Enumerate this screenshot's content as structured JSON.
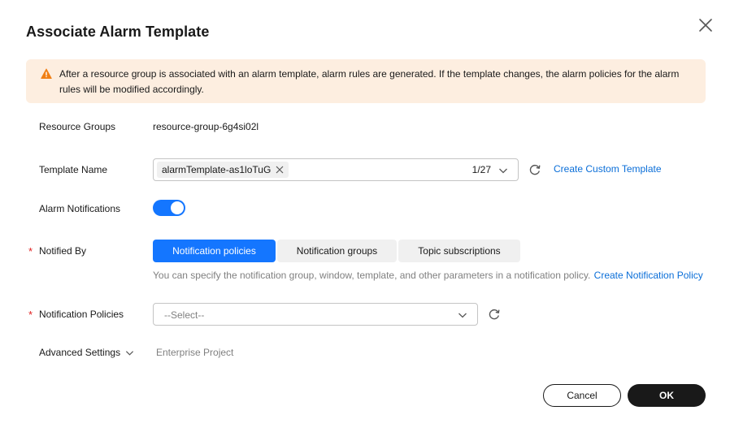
{
  "dialog": {
    "title": "Associate Alarm Template",
    "close_icon": "close-icon"
  },
  "alert": {
    "icon": "warning-icon",
    "color": "#fdeee0",
    "icon_color": "#f07f15",
    "text": "After a resource group is associated with an alarm template, alarm rules are generated. If the template changes, the alarm policies for the alarm rules will be modified accordingly."
  },
  "form": {
    "resource_groups": {
      "label": "Resource Groups",
      "value": "resource-group-6g4si02l"
    },
    "template_name": {
      "label": "Template Name",
      "tag": "alarmTemplate-as1loTuG",
      "count": "1/27",
      "refresh_icon": "refresh-icon",
      "link": "Create Custom Template"
    },
    "alarm_notifications": {
      "label": "Alarm Notifications",
      "enabled": true
    },
    "notified_by": {
      "required_mark": "*",
      "label": "Notified By",
      "options": [
        "Notification policies",
        "Notification groups",
        "Topic subscriptions"
      ],
      "selected": "Notification policies",
      "hint": "You can specify the notification group, window, template, and other parameters in a notification policy.",
      "link": "Create Notification Policy"
    },
    "notification_policies": {
      "required_mark": "*",
      "label": "Notification Policies",
      "placeholder": "--Select--",
      "refresh_icon": "refresh-icon"
    },
    "advanced": {
      "label": "Advanced Settings",
      "sub": "Enterprise Project"
    }
  },
  "footer": {
    "cancel": "Cancel",
    "ok": "OK"
  },
  "colors": {
    "accent": "#1476ff",
    "link": "#0a6ed8",
    "required": "#e02020",
    "primary_button": "#191919"
  }
}
